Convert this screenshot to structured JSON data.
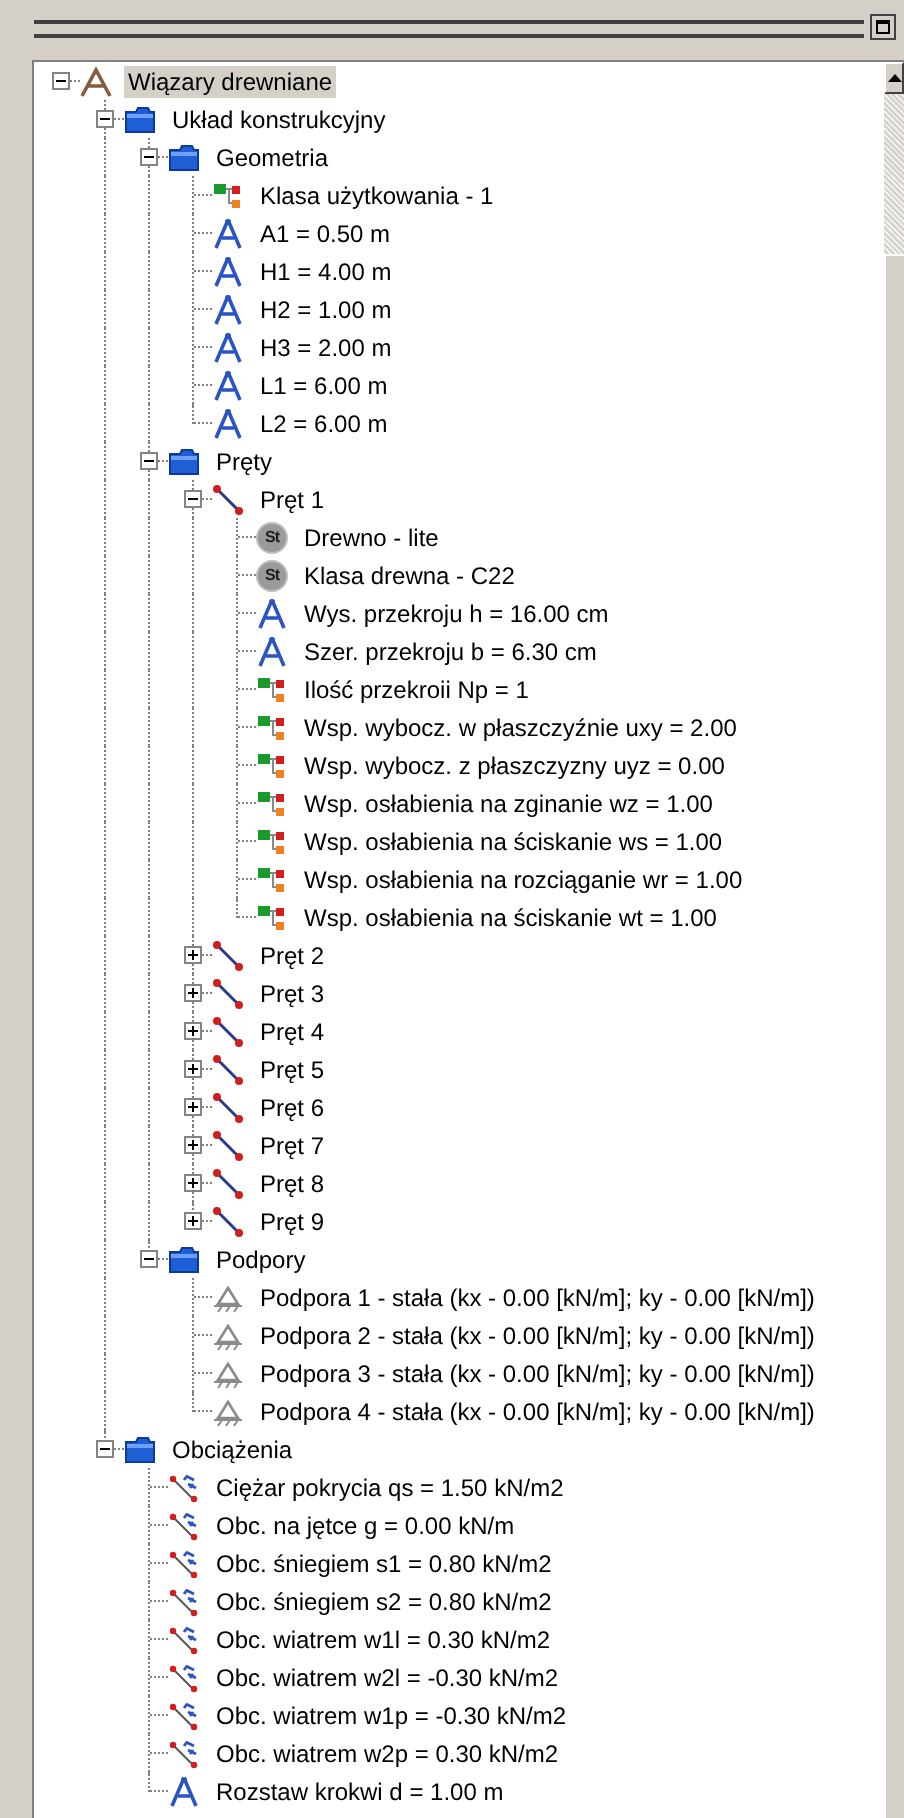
{
  "tree": [
    {
      "label": "Wiązary drewniane",
      "kind": "truss",
      "selected": true,
      "expanded": true,
      "children": [
        {
          "label": "Układ konstrukcyjny",
          "kind": "folder",
          "selected": false,
          "expanded": true,
          "children": [
            {
              "label": "Geometria",
              "kind": "folder",
              "selected": false,
              "expanded": true,
              "children": [
                {
                  "label": "Klasa użytkowania - 1",
                  "kind": "param",
                  "selected": false
                },
                {
                  "label": "A1 = 0.50 m",
                  "kind": "dimension",
                  "selected": false
                },
                {
                  "label": "H1 = 4.00 m",
                  "kind": "dimension",
                  "selected": false
                },
                {
                  "label": "H2 = 1.00 m",
                  "kind": "dimension",
                  "selected": false
                },
                {
                  "label": "H3 = 2.00 m",
                  "kind": "dimension",
                  "selected": false
                },
                {
                  "label": "L1 = 6.00 m",
                  "kind": "dimension",
                  "selected": false
                },
                {
                  "label": "L2 = 6.00 m",
                  "kind": "dimension",
                  "selected": false
                }
              ]
            },
            {
              "label": "Pręty",
              "kind": "folder",
              "selected": false,
              "expanded": true,
              "children": [
                {
                  "label": "Pręt 1",
                  "kind": "bar",
                  "selected": false,
                  "expanded": true,
                  "children": [
                    {
                      "label": "Drewno - lite",
                      "kind": "material",
                      "badge": "St",
                      "selected": false
                    },
                    {
                      "label": "Klasa drewna - C22",
                      "kind": "material",
                      "badge": "St",
                      "selected": false
                    },
                    {
                      "label": "Wys. przekroju h = 16.00 cm",
                      "kind": "dimension",
                      "selected": false
                    },
                    {
                      "label": "Szer. przekroju b = 6.30 cm",
                      "kind": "dimension",
                      "selected": false
                    },
                    {
                      "label": "Ilość przekroii Np = 1",
                      "kind": "param",
                      "selected": false
                    },
                    {
                      "label": "Wsp. wybocz. w płaszczyźnie uxy = 2.00",
                      "kind": "param",
                      "selected": false
                    },
                    {
                      "label": "Wsp. wybocz. z płaszczyzny uyz = 0.00",
                      "kind": "param",
                      "selected": false
                    },
                    {
                      "label": "Wsp. osłabienia na zginanie wz = 1.00",
                      "kind": "param",
                      "selected": false
                    },
                    {
                      "label": "Wsp. osłabienia na ściskanie ws = 1.00",
                      "kind": "param",
                      "selected": false
                    },
                    {
                      "label": "Wsp. osłabienia na rozciąganie wr = 1.00",
                      "kind": "param",
                      "selected": false
                    },
                    {
                      "label": "Wsp. osłabienia na ściskanie wt = 1.00",
                      "kind": "param",
                      "selected": false
                    }
                  ]
                },
                {
                  "label": "Pręt 2",
                  "kind": "bar",
                  "selected": false,
                  "expanded": false
                },
                {
                  "label": "Pręt 3",
                  "kind": "bar",
                  "selected": false,
                  "expanded": false
                },
                {
                  "label": "Pręt 4",
                  "kind": "bar",
                  "selected": false,
                  "expanded": false
                },
                {
                  "label": "Pręt 5",
                  "kind": "bar",
                  "selected": false,
                  "expanded": false
                },
                {
                  "label": "Pręt 6",
                  "kind": "bar",
                  "selected": false,
                  "expanded": false
                },
                {
                  "label": "Pręt 7",
                  "kind": "bar",
                  "selected": false,
                  "expanded": false
                },
                {
                  "label": "Pręt 8",
                  "kind": "bar",
                  "selected": false,
                  "expanded": false
                },
                {
                  "label": "Pręt 9",
                  "kind": "bar",
                  "selected": false,
                  "expanded": false
                }
              ]
            },
            {
              "label": "Podpory",
              "kind": "folder",
              "selected": false,
              "expanded": true,
              "children": [
                {
                  "label": "Podpora 1 - stała (kx - 0.00 [kN/m];  ky - 0.00 [kN/m])",
                  "kind": "support",
                  "selected": false
                },
                {
                  "label": "Podpora 2 - stała (kx - 0.00 [kN/m];  ky - 0.00 [kN/m])",
                  "kind": "support",
                  "selected": false
                },
                {
                  "label": "Podpora 3 - stała (kx - 0.00 [kN/m];  ky - 0.00 [kN/m])",
                  "kind": "support",
                  "selected": false
                },
                {
                  "label": "Podpora 4 - stała (kx - 0.00 [kN/m];  ky - 0.00 [kN/m])",
                  "kind": "support",
                  "selected": false
                }
              ]
            }
          ]
        },
        {
          "label": "Obciążenia",
          "kind": "folder",
          "selected": false,
          "expanded": true,
          "children": [
            {
              "label": "Ciężar pokrycia qs = 1.50 kN/m2",
              "kind": "load",
              "selected": false
            },
            {
              "label": "Obc. na jętce g = 0.00 kN/m",
              "kind": "load",
              "selected": false
            },
            {
              "label": "Obc. śniegiem s1 = 0.80 kN/m2",
              "kind": "load",
              "selected": false
            },
            {
              "label": "Obc. śniegiem s2 = 0.80 kN/m2",
              "kind": "load",
              "selected": false
            },
            {
              "label": "Obc. wiatrem w1l = 0.30 kN/m2",
              "kind": "load",
              "selected": false
            },
            {
              "label": "Obc. wiatrem w2l = -0.30 kN/m2",
              "kind": "load",
              "selected": false
            },
            {
              "label": "Obc. wiatrem w1p = -0.30 kN/m2",
              "kind": "load",
              "selected": false
            },
            {
              "label": "Obc. wiatrem w2p = 0.30 kN/m2",
              "kind": "load",
              "selected": false
            },
            {
              "label": "Rozstaw krokwi d = 1.00 m",
              "kind": "dimension",
              "selected": false
            }
          ]
        }
      ]
    }
  ]
}
